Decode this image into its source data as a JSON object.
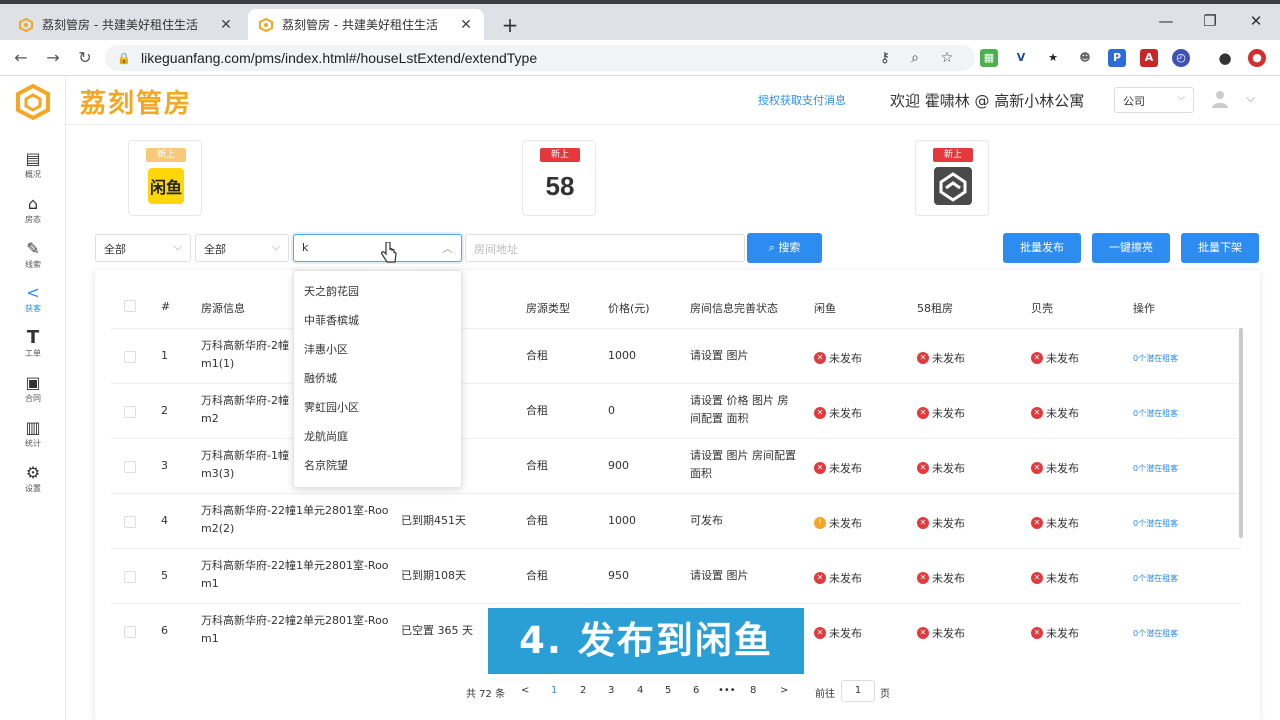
{
  "browser": {
    "tabs": [
      {
        "title": "荔刻管房 - 共建美好租住生活",
        "close": "✕"
      },
      {
        "title": "荔刻管房 - 共建美好租住生活",
        "close": "✕"
      }
    ],
    "new_tab": "+",
    "url": "likeguanfang.com/pms/index.html#/houseLstExtend/extendType"
  },
  "sidebar": {
    "items": [
      {
        "label": "概况",
        "icon": "dashboard-icon"
      },
      {
        "label": "房态",
        "icon": "house-icon"
      },
      {
        "label": "线索",
        "icon": "edit-icon"
      },
      {
        "label": "获客",
        "icon": "share-icon"
      },
      {
        "label": "工单",
        "icon": "tool-icon"
      },
      {
        "label": "合同",
        "icon": "contract-icon"
      },
      {
        "label": "统计",
        "icon": "chart-icon"
      },
      {
        "label": "设置",
        "icon": "gear-icon"
      }
    ]
  },
  "header": {
    "brand": "荔刻管房",
    "auth_link": "授权获取支付消息",
    "welcome": "欢迎 霍啸林 @ 高新小林公寓",
    "company": "公司"
  },
  "platforms": [
    {
      "name": "闲鱼",
      "badge": "新上"
    },
    {
      "name": "58",
      "badge": "新上"
    },
    {
      "name": "贝壳",
      "badge": "新上"
    }
  ],
  "filters": {
    "select1": "全部",
    "select2": "全部",
    "community_value": "k",
    "address_placeholder": "房间地址",
    "search_button": "搜索",
    "batch_publish": "批量发布",
    "one_click_refresh": "一键擦亮",
    "batch_unpublish": "批量下架"
  },
  "dropdown": {
    "options": [
      "天之韵花园",
      "中菲香槟城",
      "沣惠小区",
      "融侨城",
      "霁虹园小区",
      "龙航尚庭",
      "名京院望"
    ]
  },
  "table": {
    "headers": {
      "num": "#",
      "info": "房源信息",
      "type": "房源类型",
      "price": "价格(元)",
      "completion": "房间信息完善状态",
      "xianyu": "闲鱼",
      "zufang58": "58租房",
      "beike": "贝壳",
      "ops": "操作"
    },
    "rows": [
      {
        "num": "1",
        "info1": "万科高新华府-2幢",
        "info2": "m1(1)",
        "vacancy": "",
        "type": "合租",
        "price": "1000",
        "comp1": "请设置 图片",
        "comp2": "",
        "xianyu": "未发布",
        "xianyu_warn": false,
        "s58": "未发布",
        "beike": "未发布",
        "op": "0个潜在租客"
      },
      {
        "num": "2",
        "info1": "万科高新华府-2幢",
        "info2": "m2",
        "vacancy": "",
        "type": "合租",
        "price": "0",
        "comp1": "请设置 价格 图片 房",
        "comp2": "间配置 面积",
        "xianyu": "未发布",
        "xianyu_warn": false,
        "s58": "未发布",
        "beike": "未发布",
        "op": "0个潜在租客"
      },
      {
        "num": "3",
        "info1": "万科高新华府-1幢",
        "info2": "m3(3)",
        "vacancy": "",
        "type": "合租",
        "price": "900",
        "comp1": "请设置 图片 房间配置",
        "comp2": "面积",
        "xianyu": "未发布",
        "xianyu_warn": false,
        "s58": "未发布",
        "beike": "未发布",
        "op": "0个潜在租客"
      },
      {
        "num": "4",
        "info1": "万科高新华府-22幢1单元2801室-Roo",
        "info2": "m2(2)",
        "vacancy": "已到期451天",
        "type": "合租",
        "price": "1000",
        "comp1": "可发布",
        "comp2": "",
        "xianyu": "未发布",
        "xianyu_warn": true,
        "s58": "未发布",
        "beike": "未发布",
        "op": "0个潜在租客"
      },
      {
        "num": "5",
        "info1": "万科高新华府-22幢1单元2801室-Roo",
        "info2": "m1",
        "vacancy": "已到期108天",
        "type": "合租",
        "price": "950",
        "comp1": "请设置 图片",
        "comp2": "",
        "xianyu": "未发布",
        "xianyu_warn": false,
        "s58": "未发布",
        "beike": "未发布",
        "op": "0个潜在租客"
      },
      {
        "num": "6",
        "info1": "万科高新华府-22幢2单元2801室-Roo",
        "info2": "m1",
        "vacancy": "已空置 365 天",
        "type": "",
        "price": "",
        "comp1": "",
        "comp2": "",
        "xianyu": "未发布",
        "xianyu_warn": false,
        "s58": "未发布",
        "beike": "未发布",
        "op": "0个潜在租客"
      }
    ]
  },
  "pagination": {
    "total": "共 72 条",
    "prev": "<",
    "pages": [
      "1",
      "2",
      "3",
      "4",
      "5",
      "6",
      "•••",
      "8"
    ],
    "next": ">",
    "goto_label": "前往",
    "goto_value": "1",
    "page_suffix": "页"
  },
  "caption": "4. 发布到闲鱼",
  "colors": {
    "brand": "#f5a623",
    "primary": "#2d8cf0",
    "danger": "#e4393c",
    "caption_bg": "#2a9fd6"
  }
}
